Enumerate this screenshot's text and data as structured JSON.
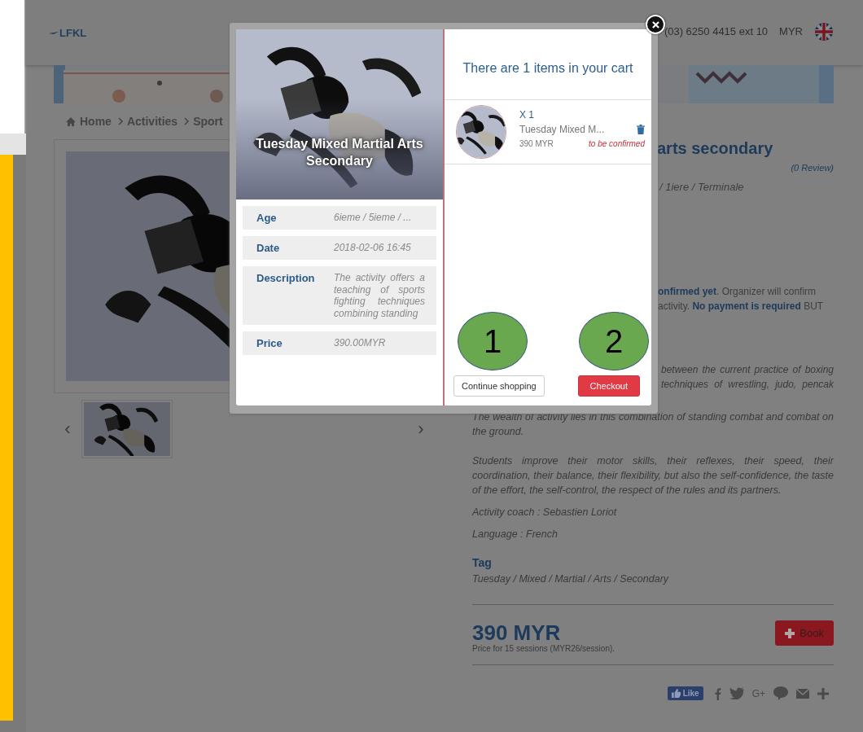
{
  "header": {
    "logo": "LFKL",
    "phone": "(03) 6250 4415 ext 10",
    "currency": "MYR"
  },
  "breadcrumb": [
    "Home",
    "Activities",
    "Sport"
  ],
  "gallery": {
    "prev": "‹",
    "next": "›"
  },
  "detail": {
    "title_fragment": "arts secondary",
    "reviews": "(0 Review)",
    "age_fragment": "/ 1iere / Terminale",
    "notice_lines": [
      "**onfirmed yet**. Organizer will confirm",
      "activity. **No payment is required** BUT"
    ],
    "intro_lines": [
      "between the current practice of boxing",
      "techniques of wrestling, judo, pencak"
    ],
    "paragraphs": [
      "The wealth of activity lies in this combination of standing combat and combat on the ground.",
      "Students improve their motor skills, their reflexes, their speed, their coordination, their balance, their flexibility, but also the self-confidence, the taste of the effort, the self-control, the respect of the rules and its partners."
    ],
    "coach": "Activity coach : Sebastien Loriot",
    "language": "Language : French",
    "tag_heading": "Tag",
    "tags": "Tuesday / Mixed / Martial / Arts / Secondary",
    "price": "390 MYR",
    "price_note": "Price for 15 sessions (MYR26/session).",
    "book_button": "Book",
    "like_button": "Like",
    "google_plus": "G+"
  },
  "modal": {
    "product_title": "Tuesday Mixed Martial Arts Secondary",
    "info": [
      {
        "label": "Age",
        "value": "6ieme / 5ieme / ..."
      },
      {
        "label": "Date",
        "value": "2018-02-06 16:45"
      },
      {
        "label": "Description",
        "value": "The activity offers a teaching of sports fighting techniques combining standing"
      },
      {
        "label": "Price",
        "value": "390.00MYR"
      }
    ],
    "cart_heading": "There are 1 items in your cart",
    "items": [
      {
        "quantity": "X 1",
        "name": "Tuesday Mixed M...",
        "price": "390 MYR",
        "status": "to be confirmed"
      }
    ],
    "buttons": [
      {
        "label": "Continue shopping",
        "kind": "secondary"
      },
      {
        "label": "Checkout",
        "kind": "primary"
      }
    ]
  },
  "annotations": [
    {
      "label": "1"
    },
    {
      "label": "2"
    }
  ]
}
